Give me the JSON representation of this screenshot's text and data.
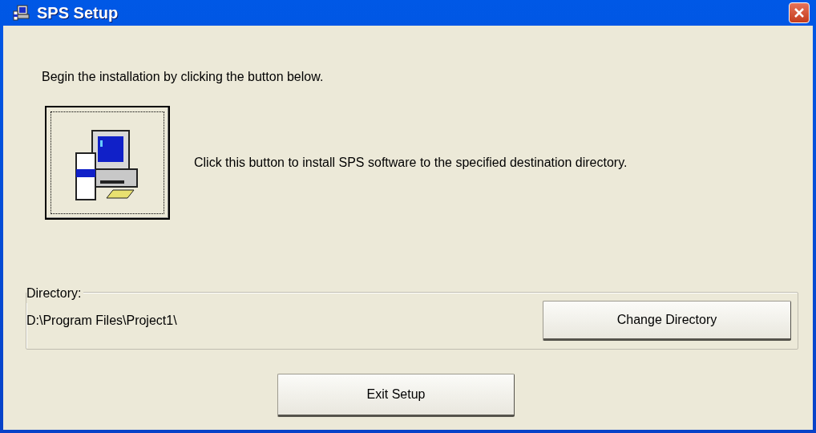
{
  "window": {
    "title": "SPS Setup"
  },
  "intro": "Begin the installation by clicking the button below.",
  "install": {
    "description": "Click this button to install SPS software to the specified destination directory.",
    "focused": true
  },
  "directory": {
    "legend": "Directory:",
    "path": "D:\\Program Files\\Project1\\",
    "button": "Change Directory"
  },
  "buttons": [
    "Exit Setup"
  ]
}
